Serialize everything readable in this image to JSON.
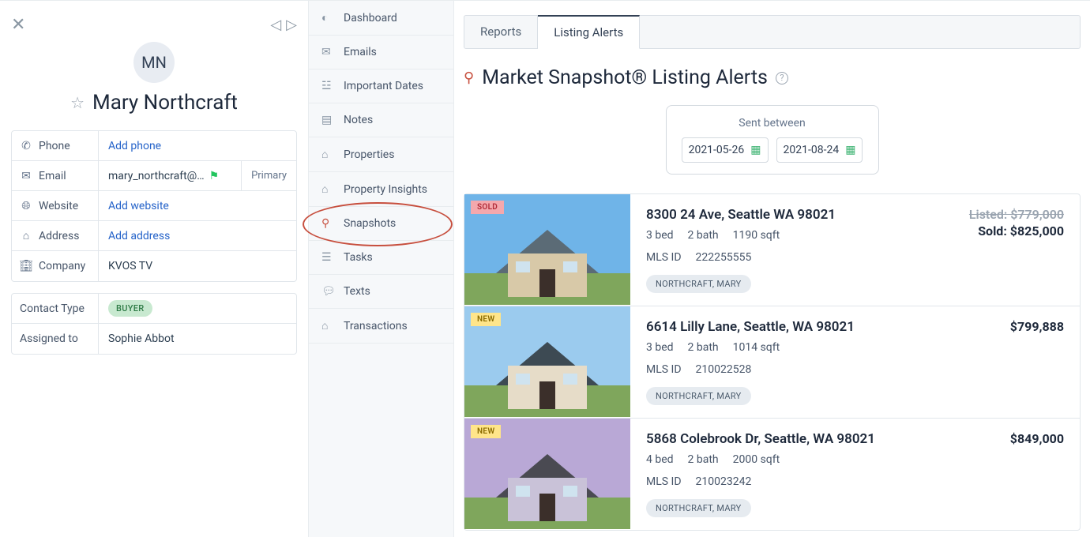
{
  "contact": {
    "initials": "MN",
    "name": "Mary Northcraft",
    "fields": {
      "phone_label": "Phone",
      "phone_value": "Add phone",
      "email_label": "Email",
      "email_value": "mary_northcraft@…",
      "email_tag": "Primary",
      "website_label": "Website",
      "website_value": "Add website",
      "address_label": "Address",
      "address_value": "Add address",
      "company_label": "Company",
      "company_value": "KVOS TV"
    },
    "meta": {
      "contact_type_label": "Contact Type",
      "contact_type_value": "BUYER",
      "assigned_label": "Assigned to",
      "assigned_value": "Sophie Abbot"
    }
  },
  "nav": {
    "dashboard": "Dashboard",
    "emails": "Emails",
    "important_dates": "Important Dates",
    "notes": "Notes",
    "properties": "Properties",
    "property_insights": "Property Insights",
    "snapshots": "Snapshots",
    "tasks": "Tasks",
    "texts": "Texts",
    "transactions": "Transactions"
  },
  "tabs": {
    "reports": "Reports",
    "listing_alerts": "Listing Alerts"
  },
  "page_title": "Market Snapshot® Listing Alerts",
  "date_filter": {
    "label": "Sent between",
    "from": "2021-05-26",
    "to": "2021-08-24"
  },
  "listings": [
    {
      "badge": "SOLD",
      "badge_type": "sold",
      "address": "8300 24 Ave, Seattle WA 98021",
      "beds": "3 bed",
      "baths": "2 bath",
      "sqft": "1190 sqft",
      "mls_label": "MLS ID",
      "mls_id": "222255555",
      "agent": "NORTHCRAFT, MARY",
      "price_listed": "Listed: $779,000",
      "price_sold": "Sold: $825,000"
    },
    {
      "badge": "NEW",
      "badge_type": "new",
      "address": "6614 Lilly Lane, Seattle, WA 98021",
      "beds": "3 bed",
      "baths": "2 bath",
      "sqft": "1014 sqft",
      "mls_label": "MLS ID",
      "mls_id": "210022528",
      "agent": "NORTHCRAFT, MARY",
      "price": "$799,888"
    },
    {
      "badge": "NEW",
      "badge_type": "new",
      "address": "5868 Colebrook Dr, Seattle, WA 98021",
      "beds": "4 bed",
      "baths": "2 bath",
      "sqft": "2000 sqft",
      "mls_label": "MLS ID",
      "mls_id": "210023242",
      "agent": "NORTHCRAFT, MARY",
      "price": "$849,000"
    }
  ]
}
